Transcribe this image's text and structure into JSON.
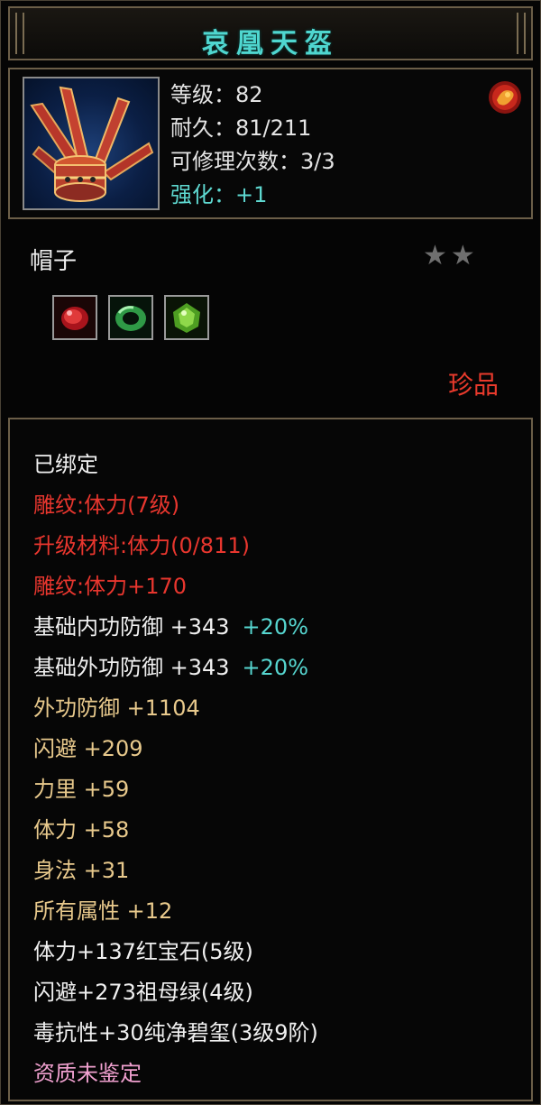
{
  "title": "哀凰天盔",
  "header": {
    "level": "等级：82",
    "durability": "耐久：81/211",
    "repair": "可修理次数：3/3",
    "enhance": "强化：+1",
    "item_icon": "helmet-icon",
    "seal_icon": "seal-badge-icon"
  },
  "item_type": "帽子",
  "stars": {
    "filled": 0,
    "total": 2,
    "icon": "star-icon"
  },
  "gems": [
    {
      "icon": "ruby-gem-icon",
      "color": "#c8202a"
    },
    {
      "icon": "jade-ring-icon",
      "color": "#3ba24a"
    },
    {
      "icon": "emerald-gem-icon",
      "color": "#69c22f"
    }
  ],
  "quality": "珍品",
  "colors": {
    "title": "#4fd6cf",
    "red": "#e8362e",
    "gold": "#e8c98c",
    "cyan": "#56d6d0",
    "pink": "#f0a0cf"
  },
  "attributes": [
    {
      "text": "已绑定",
      "pct": "",
      "color": "white"
    },
    {
      "text": "雕纹:体力(7级)",
      "pct": "",
      "color": "red"
    },
    {
      "text": "升级材料:体力(0/811)",
      "pct": "",
      "color": "red"
    },
    {
      "text": "雕纹:体力+170",
      "pct": "",
      "color": "red"
    },
    {
      "text": "基础内功防御 +343",
      "pct": "+20%",
      "color": "white"
    },
    {
      "text": "基础外功防御 +343",
      "pct": "+20%",
      "color": "white"
    },
    {
      "text": "外功防御 +1104",
      "pct": "",
      "color": "gold"
    },
    {
      "text": "闪避 +209",
      "pct": "",
      "color": "gold"
    },
    {
      "text": "力里 +59",
      "pct": "",
      "color": "gold"
    },
    {
      "text": "体力 +58",
      "pct": "",
      "color": "gold"
    },
    {
      "text": "身法 +31",
      "pct": "",
      "color": "gold"
    },
    {
      "text": "所有属性 +12",
      "pct": "",
      "color": "gold"
    },
    {
      "text": "体力+137红宝石(5级)",
      "pct": "",
      "color": "white"
    },
    {
      "text": "闪避+273祖母绿(4级)",
      "pct": "",
      "color": "white"
    },
    {
      "text": "毒抗性+30纯净碧玺(3级9阶)",
      "pct": "",
      "color": "white"
    },
    {
      "text": "资质未鉴定",
      "pct": "",
      "color": "pink"
    }
  ]
}
